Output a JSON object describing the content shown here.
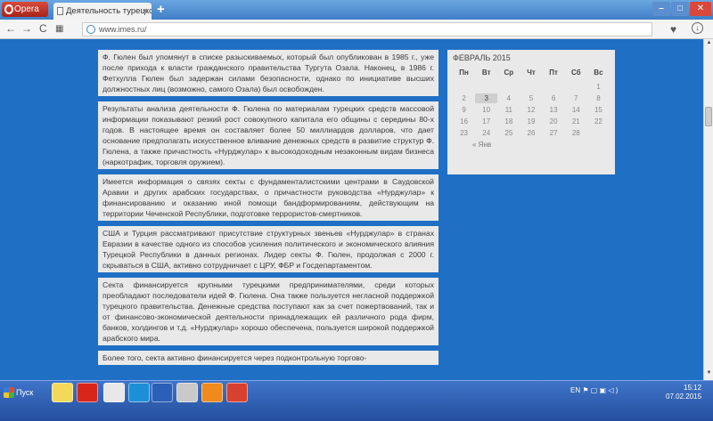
{
  "browser": {
    "app_label": "Opera",
    "tab_title": "Деятельность турецкой ре",
    "url": "www.imes.ru/"
  },
  "article": {
    "paragraphs": [
      "Ф. Гюлен был упомянут в списке разыскиваемых, который был опубликован в 1985 г., уже после прихода к власти гражданского правительства Тургута Озала. Наконец, в 1986 г. Фетхулла Гюлен был задержан силами безопасности, однако по инициативе высших должностных лиц (возможно, самого Озала) был освобожден.",
      "Результаты анализа деятельности Ф. Гюлена по материалам турецких средств массовой информации показывают резкий рост совокупного капитала его общины с середины 80-х годов. В настоящее время он составляет более 50 миллиардов долларов, что дает основание предполагать искусственное вливание денежных средств в развитие структур Ф. Гюлена, а также причастность «Нурджулар» к высокодоходным незаконным видам бизнеса (наркотрафик, торговля оружием).",
      "Имеется информация о связях секты с фундаменталистскими центрами в Саудовской Аравии и других арабских государствах, о причастности руководства «Нурджулар» к финансированию и оказанию иной помощи бандформированиям, действующим на территории Чеченской Республики, подготовке террористов-смертников.",
      "США и Турция рассматривают присутствие структурных звеньев «Нурджулар» в странах Евразии в качестве одного из способов усиления политического и экономического влияния Турецкой Республики в данных регионах. Лидер секты Ф. Гюлен, продолжая с 2000 г. скрываться в США, активно сотрудничает с ЦРУ, ФБР и Госдепартаментом.",
      "Секта финансируется крупными турецкими предпринимателями, среди которых преобладают последователи идей Ф. Гюлена. Она также пользуется негласной поддержкой турецкого правительства. Денежные средства поступают как за счет пожертвований, так и от финансово-экономической деятельности принадлежащих ей различного рода фирм, банков, холдингов и т.д. «Нурджулар» хорошо обеспечена, пользуется широкой поддержкой арабского мира.",
      "Более того, секта активно финансируется через подконтрольную торгово-"
    ]
  },
  "calendar": {
    "title": "ФЕВРАЛЬ 2015",
    "weekdays": [
      "Пн",
      "Вт",
      "Ср",
      "Чт",
      "Пт",
      "Сб",
      "Вс"
    ],
    "cells": [
      "",
      "",
      "",
      "",
      "",
      "",
      "1",
      "2",
      "3",
      "4",
      "5",
      "6",
      "7",
      "8",
      "9",
      "10",
      "11",
      "12",
      "13",
      "14",
      "15",
      "16",
      "17",
      "18",
      "19",
      "20",
      "21",
      "22",
      "23",
      "24",
      "25",
      "26",
      "27",
      "28",
      ""
    ],
    "today": "3",
    "prev_link": "« Янв"
  },
  "taskbar": {
    "start_label": "Пуск",
    "lang": "EN",
    "time": "15:12",
    "date": "07.02.2015",
    "item_colors": [
      "#f3d85a",
      "#d8261b",
      "#e8e8e8",
      "#1c8fd6",
      "#2b5fb8",
      "#c9c9c9",
      "#f08a1c",
      "#d84030"
    ]
  }
}
